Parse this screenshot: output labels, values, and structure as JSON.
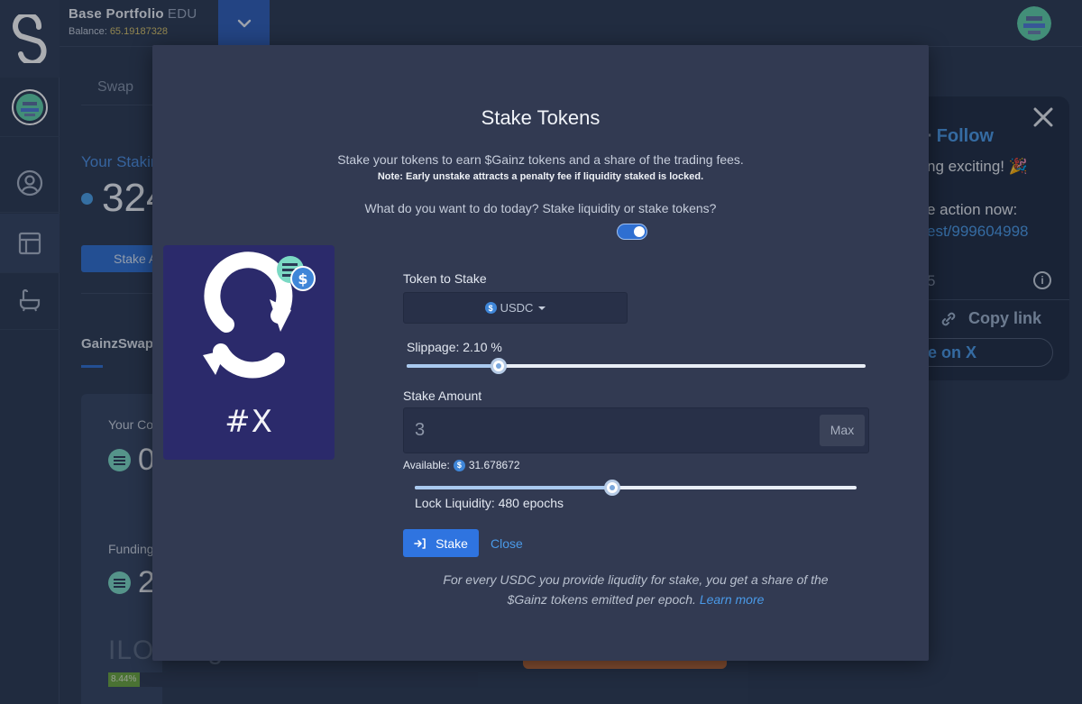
{
  "topbar": {
    "portfolio_name": "Base Portfolio",
    "network": "EDU",
    "balance_label": "Balance:",
    "balance_value": "65.19187328"
  },
  "background": {
    "tab_swap": "Swap",
    "staking_title": "Your Stakin",
    "staking_amount": "324",
    "stake_button": "Stake A",
    "gainzswap_heading": "GainzSwap I",
    "card_label_1": "Your Co",
    "card_value_1": "0",
    "card_label_2": "Funding",
    "card_value_2": "2",
    "ilo_text": "ILO Progress",
    "ilo_percent": 8.44,
    "ilo_percent_label": "8.44%"
  },
  "tweet": {
    "separator": "·",
    "follow": "Follow",
    "line1": "ng exciting! 🎉",
    "line2": "e action now:",
    "line3": "est/999604998",
    "line4": "5",
    "copy_link": "Copy link",
    "share": "e on X"
  },
  "modal": {
    "title": "Stake Tokens",
    "subtitle": "Stake your tokens to earn $Gainz tokens and a share of the trading fees.",
    "note": "Note: Early unstake attracts a penalty fee if liquidity staked is locked.",
    "question": "What do you want to do today? Stake liquidity or stake tokens?",
    "toggle_on": true,
    "promo_tag": "#X",
    "token_label": "Token to Stake",
    "token_selected": "USDC",
    "slippage_label": "Slippage: 2.10 %",
    "slippage_fraction": 0.2,
    "amount_label": "Stake Amount",
    "amount_value": "3",
    "max_label": "Max",
    "available_label": "Available:",
    "available_value": "31.678672",
    "lock_fraction": 0.447,
    "lock_label": "Lock Liquidity: 480 epochs",
    "stake_button": "Stake",
    "close_link": "Close",
    "footer_text": "For every USDC you provide liqudity for stake, you get a share of the $Gainz tokens emitted per epoch.",
    "learn_more": "Learn more"
  },
  "colors": {
    "accent": "#2f74e0",
    "link": "#4a9ae8",
    "modal_bg": "#323a52",
    "promo_bg": "#2b2a6b"
  }
}
